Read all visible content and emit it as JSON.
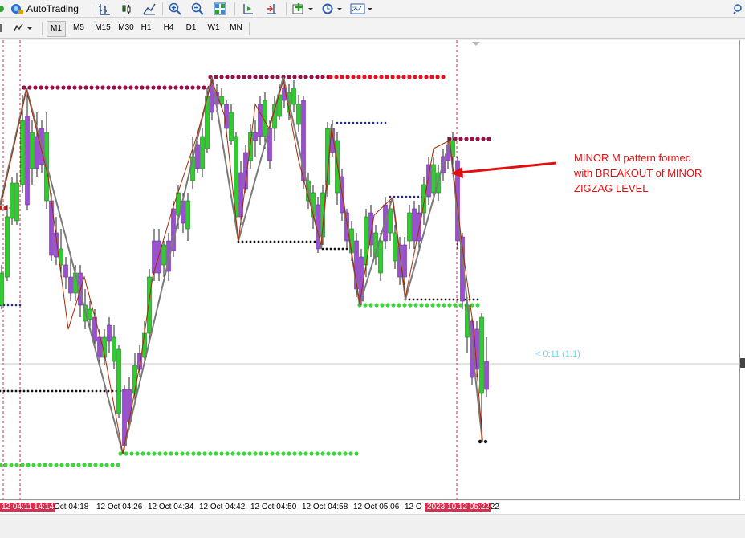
{
  "toolbar": {
    "autotrading_label": "AutoTrading",
    "timeframes": [
      "M1",
      "M5",
      "M15",
      "M30",
      "H1",
      "H4",
      "D1",
      "W1",
      "MN"
    ],
    "active_timeframe": "M1"
  },
  "chart": {
    "annotation_lines": [
      "MINOR M pattern formed",
      "with BREAKOUT of MINOR",
      "ZIGZAG  LEVEL"
    ],
    "countdown": "< 0:11 (1.1)",
    "colors": {
      "bull": "#2ecc2e",
      "bear": "#9b4fd3",
      "zigzag_grey": "#7a7a7a",
      "zigzag_red": "#a52a00",
      "resistance_dots": "#9a0f4a",
      "resistance_dots_alt": "#e8101a",
      "support_dots": "#3ed43e",
      "minor_dots_blue": "#1a2a9a",
      "minor_dots_black": "#111111",
      "annotation": "#e01010",
      "highlight_label": "#d2314f"
    }
  },
  "x_axis": {
    "labels": [
      "12 04:11",
      "14:14",
      "Oct 04:18",
      "12 Oct 04:26",
      "12 Oct 04:34",
      "12 Oct 04:42",
      "12 Oct 04:50",
      "12 Oct 04:58",
      "12 Oct 05:06",
      "12 O",
      "2023.10.12 05:22",
      ":22"
    ]
  }
}
